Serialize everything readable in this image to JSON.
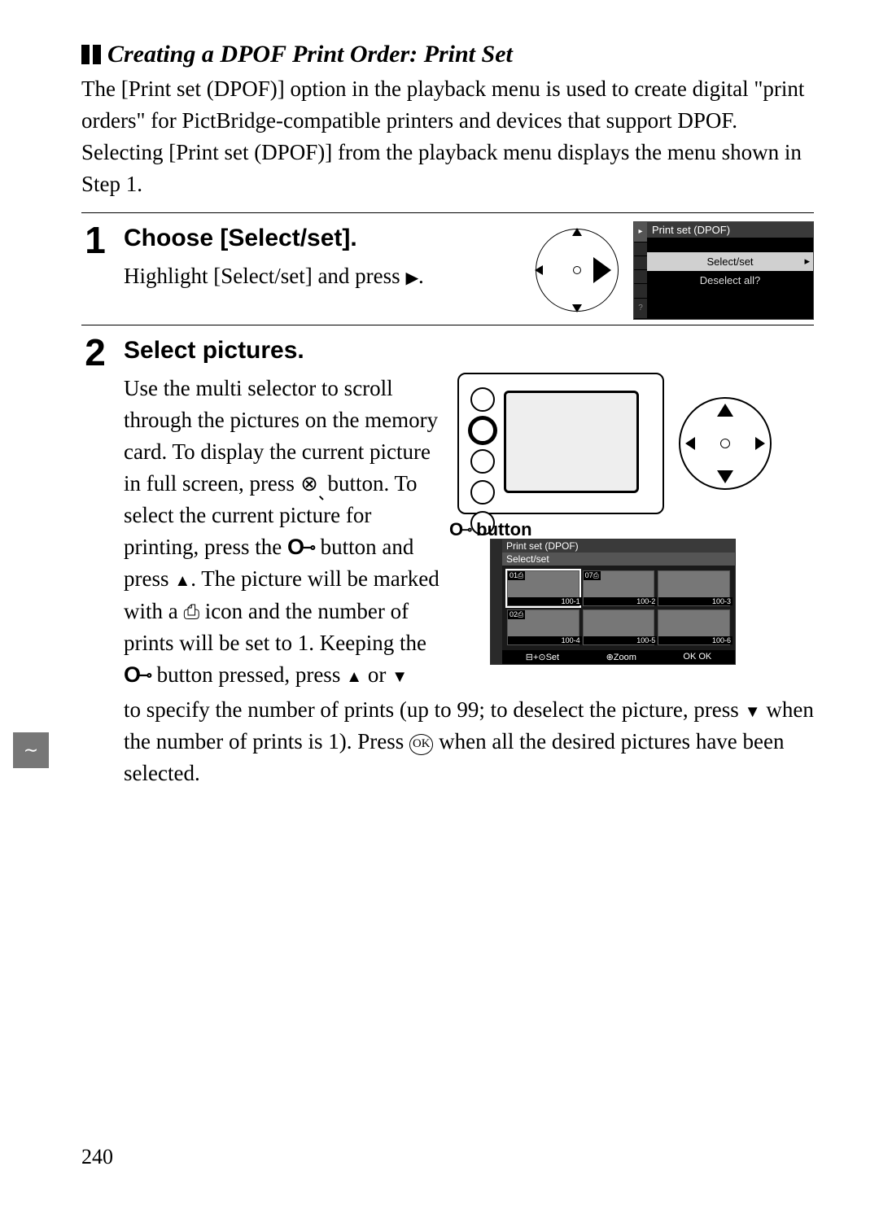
{
  "heading": "Creating a DPOF Print Order: Print Set",
  "intro": "The [Print set (DPOF)] option in the playback menu is used to create digital \"print orders\" for PictBridge-compatible printers and devices that support DPOF.  Selecting [Print set (DPOF)] from the playback menu displays the menu shown in Step 1.",
  "step1": {
    "num": "1",
    "title": "Choose [Select/set].",
    "text_a": "Highlight [Select/set] and press ",
    "text_b": ".",
    "menu": {
      "title": "Print set (DPOF)",
      "item_selected": "Select/set",
      "item2": "Deselect all?"
    }
  },
  "step2": {
    "num": "2",
    "title": "Select pictures.",
    "p1a": "Use the multi selector to scroll through the pictures on the memory card.  To display the current picture in full screen, press ",
    "p1b": " button.  To select the current picture for printing, press the ",
    "p1c": " button and press ",
    "p1d": ".  The picture will be marked with a ",
    "p1e": " icon and the number of prints will be set to 1.  Keeping the ",
    "p1f": " button pressed, press ",
    "p1g": " or ",
    "p2a": "to specify the number of prints (up to 99; to deselect the picture, press ",
    "p2b": " when the number of prints is 1).  Press ",
    "p2c": " when all the desired pictures have been selected.",
    "caption": " button",
    "lcd": {
      "title1": "Print set (DPOF)",
      "title2": "Select/set",
      "thumbs": [
        {
          "badge": "01⎙",
          "folder": "100-1"
        },
        {
          "badge": "07⎙",
          "folder": "100-2"
        },
        {
          "badge": "",
          "folder": "100-3"
        },
        {
          "badge": "02⎙",
          "folder": "100-4"
        },
        {
          "badge": "",
          "folder": "100-5"
        },
        {
          "badge": "",
          "folder": "100-6"
        }
      ],
      "footer": {
        "set": "⊟+⊙Set",
        "zoom": "⊕Zoom",
        "ok": "OK OK"
      }
    }
  },
  "page_number": "240"
}
